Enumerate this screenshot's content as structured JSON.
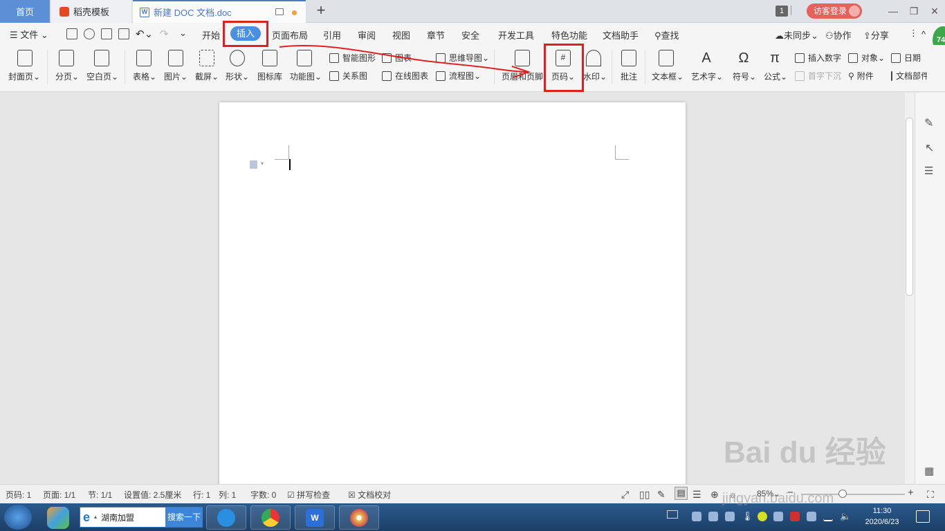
{
  "tabs": {
    "home": "首页",
    "template": "稻壳模板",
    "document": "新建 DOC 文档.doc",
    "new_tab": "+"
  },
  "titlebar": {
    "window_count": "1",
    "login": "访客登录",
    "minimize": "—",
    "restore": "❐",
    "close": "✕"
  },
  "menu": {
    "file": "文件",
    "items": [
      "开始",
      "插入",
      "页面布局",
      "引用",
      "审阅",
      "视图",
      "章节",
      "安全",
      "开发工具",
      "特色功能",
      "文档助手"
    ],
    "search": "查找",
    "sync": "未同步",
    "collab": "协作",
    "share": "分享",
    "more": "⋮",
    "collapse": "^",
    "badge": "74"
  },
  "ribbon": {
    "cover": "封面页",
    "pagebreak": "分页",
    "blank": "空白页",
    "table": "表格",
    "picture": "图片",
    "screenshot": "截屏",
    "shape": "形状",
    "iconlib": "图标库",
    "funcchart": "功能图",
    "smartart": "智能图形",
    "chart": "图表",
    "mindmap": "思维导图",
    "relation": "关系图",
    "online_chart": "在线图表",
    "flowchart": "流程图",
    "header_footer": "页眉和页脚",
    "page_number": "页码",
    "watermark": "水印",
    "comment": "批注",
    "textbox": "文本框",
    "wordart": "艺术字",
    "symbol": "符号",
    "formula": "公式",
    "insert_number": "插入数字",
    "object": "对象",
    "date": "日期",
    "dropcap": "首字下沉",
    "attachment": "附件",
    "doc_parts": "文档部件"
  },
  "statusbar": {
    "page_num": "页码: 1",
    "pages": "页面: 1/1",
    "section": "节: 1/1",
    "setting": "设置值: 2.5厘米",
    "row": "行: 1",
    "col": "列: 1",
    "wordcount": "字数: 0",
    "spellcheck": "拼写检查",
    "proofread": "文档校对",
    "zoom": "85%"
  },
  "taskbar": {
    "search_input": "湖南加盟",
    "search_btn": "搜索一下",
    "time": "11:30",
    "date": "2020/6/23"
  },
  "watermark": {
    "brand": "Bai du 经验",
    "url": "jingyan.baidu.com"
  }
}
